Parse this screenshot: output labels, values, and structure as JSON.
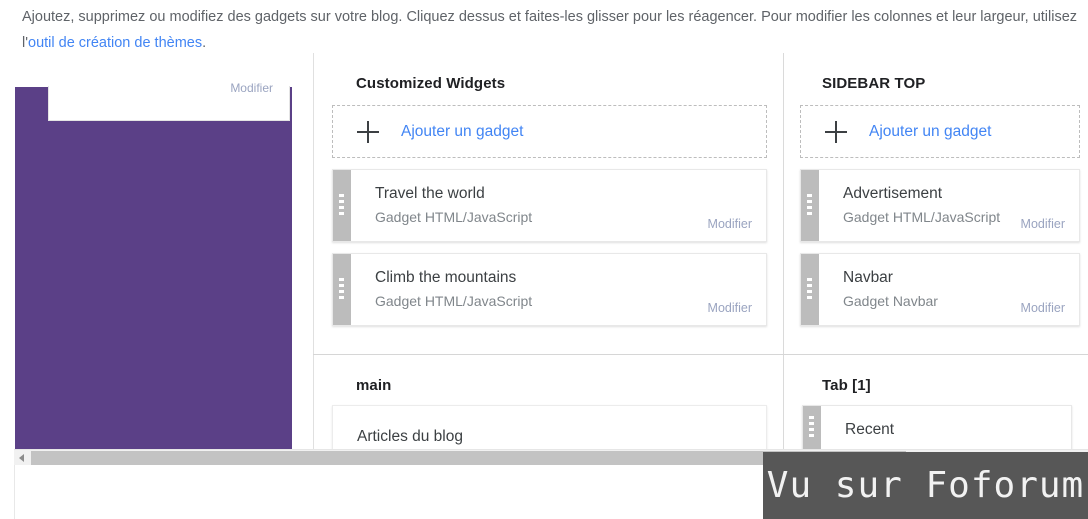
{
  "header": {
    "description_part1": "Ajoutez, supprimez ou modifiez des gadgets sur votre blog. Cliquez dessus et faites-les glisser pour les réagencer. Pour modifier les colonnes et leur largeur, utilisez l'",
    "link_text": "outil de création de thèmes",
    "description_part2": ".",
    "link_color": "#4285f4"
  },
  "preview": {
    "block_color": "#5b4087",
    "card_edit_label": "Modifier"
  },
  "sections": [
    {
      "key": "customized_widgets",
      "title": "Customized Widgets",
      "add_label": "Ajouter un gadget",
      "gadgets": [
        {
          "title": "Travel the world",
          "subtitle": "Gadget HTML/JavaScript",
          "edit_label": "Modifier"
        },
        {
          "title": "Climb the mountains",
          "subtitle": "Gadget HTML/JavaScript",
          "edit_label": "Modifier"
        }
      ]
    },
    {
      "key": "sidebar_top",
      "title": "SIDEBAR TOP",
      "add_label": "Ajouter un gadget",
      "gadgets": [
        {
          "title": "Advertisement",
          "subtitle": "Gadget HTML/JavaScript",
          "edit_label": "Modifier"
        },
        {
          "title": "Navbar",
          "subtitle": "Gadget Navbar",
          "edit_label": "Modifier"
        }
      ]
    },
    {
      "key": "main",
      "title": "main",
      "gadgets": [
        {
          "title": "Articles du blog"
        }
      ]
    },
    {
      "key": "tab_1",
      "title": "Tab [1]",
      "gadgets": [
        {
          "title": "Recent"
        }
      ]
    }
  ],
  "scrollbar": {
    "left_arrow_icon": "chevron-left-icon"
  },
  "watermark": {
    "text": "Vu sur Foforum",
    "background": "#575757"
  }
}
